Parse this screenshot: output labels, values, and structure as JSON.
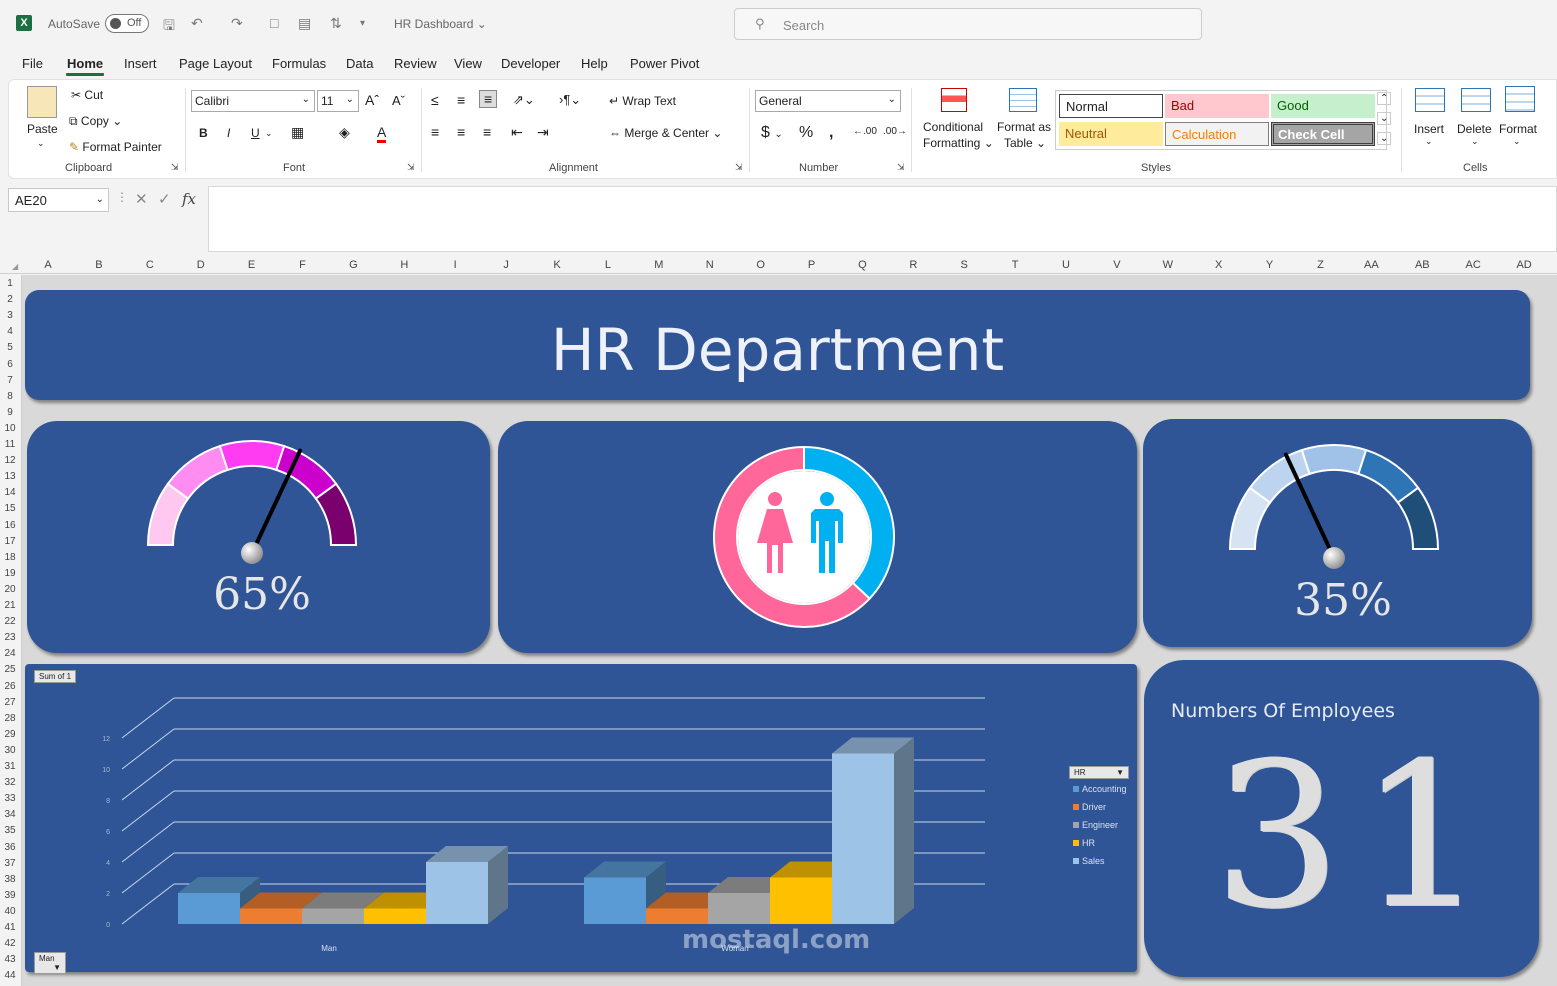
{
  "titlebar": {
    "autosave_label": "AutoSave",
    "autosave_state": "Off",
    "filename": "HR Dashboard",
    "search_placeholder": "Search"
  },
  "menu": [
    "File",
    "Home",
    "Insert",
    "Page Layout",
    "Formulas",
    "Data",
    "Review",
    "View",
    "Developer",
    "Help",
    "Power Pivot"
  ],
  "ribbon": {
    "clipboard": {
      "paste": "Paste",
      "cut": "Cut",
      "copy": "Copy",
      "format_painter": "Format Painter",
      "label": "Clipboard"
    },
    "font": {
      "name": "Calibri",
      "size": "11",
      "label": "Font",
      "bold": "B",
      "italic": "I",
      "underline": "U"
    },
    "alignment": {
      "wrap": "Wrap Text",
      "merge": "Merge & Center",
      "label": "Alignment"
    },
    "number": {
      "format": "General",
      "label": "Number"
    },
    "styles": {
      "conditional": "Conditional",
      "formatting": "Formatting",
      "format_as": "Format as",
      "table": "Table",
      "normal": "Normal",
      "bad": "Bad",
      "good": "Good",
      "neutral": "Neutral",
      "calculation": "Calculation",
      "check_cell": "Check Cell",
      "label": "Styles"
    },
    "cells": {
      "insert": "Insert",
      "delete": "Delete",
      "format": "Format",
      "label": "Cells"
    },
    "colors": {
      "bad_bg": "#ffc7ce",
      "bad_fg": "#9c0006",
      "good_bg": "#c6efce",
      "good_fg": "#006100",
      "neutral_bg": "#ffeb9c",
      "neutral_fg": "#9c5700",
      "calc_fg": "#fa7d00",
      "check_bg": "#a5a5a5"
    }
  },
  "formula_bar": {
    "name_box": "AE20",
    "fx": "fx"
  },
  "columns": [
    "A",
    "B",
    "C",
    "D",
    "E",
    "F",
    "G",
    "H",
    "I",
    "J",
    "K",
    "L",
    "M",
    "N",
    "O",
    "P",
    "Q",
    "R",
    "S",
    "T",
    "U",
    "V",
    "W",
    "X",
    "Y",
    "Z",
    "AA",
    "AB",
    "AC",
    "AD"
  ],
  "rows_count": 44,
  "dashboard": {
    "title": "HR Department",
    "gauge_left": {
      "value": 65,
      "label": "65%",
      "band_colors": [
        "#ffc8f0",
        "#ff8cf0",
        "#ff3cf2",
        "#cc00cc",
        "#7a006e"
      ]
    },
    "gauge_right": {
      "value": 35,
      "label": "35%",
      "band_colors": [
        "#d6e3f3",
        "#bdd4ee",
        "#a0c2e8",
        "#2e75b6",
        "#1f4e79"
      ]
    },
    "gender_donut": {
      "woman_color": "#ff6699",
      "man_color": "#00b0f0",
      "woman_share": 0.63,
      "man_share": 0.37
    },
    "employees": {
      "title": "Numbers Of Employees",
      "count": "31"
    },
    "watermark": "mostaql.com"
  },
  "chart_data": {
    "type": "bar",
    "categories": [
      "Man",
      "Woman"
    ],
    "series": [
      {
        "name": "Accounting",
        "values": [
          2,
          3
        ]
      },
      {
        "name": "Driver",
        "values": [
          1,
          1
        ]
      },
      {
        "name": "Engineer",
        "values": [
          1,
          2
        ]
      },
      {
        "name": "HR",
        "values": [
          1,
          3
        ]
      },
      {
        "name": "Sales",
        "values": [
          4,
          11
        ]
      }
    ],
    "series_colors": [
      "#5b9bd5",
      "#ed7d31",
      "#a5a5a5",
      "#ffc000",
      "#9dc3e6"
    ],
    "y_ticks": [
      "0",
      "2",
      "4",
      "6",
      "8",
      "10",
      "12"
    ],
    "ylim": [
      0,
      12
    ],
    "legend_field": "HR",
    "value_field": "Sum of 1",
    "axis_field": "Man"
  }
}
